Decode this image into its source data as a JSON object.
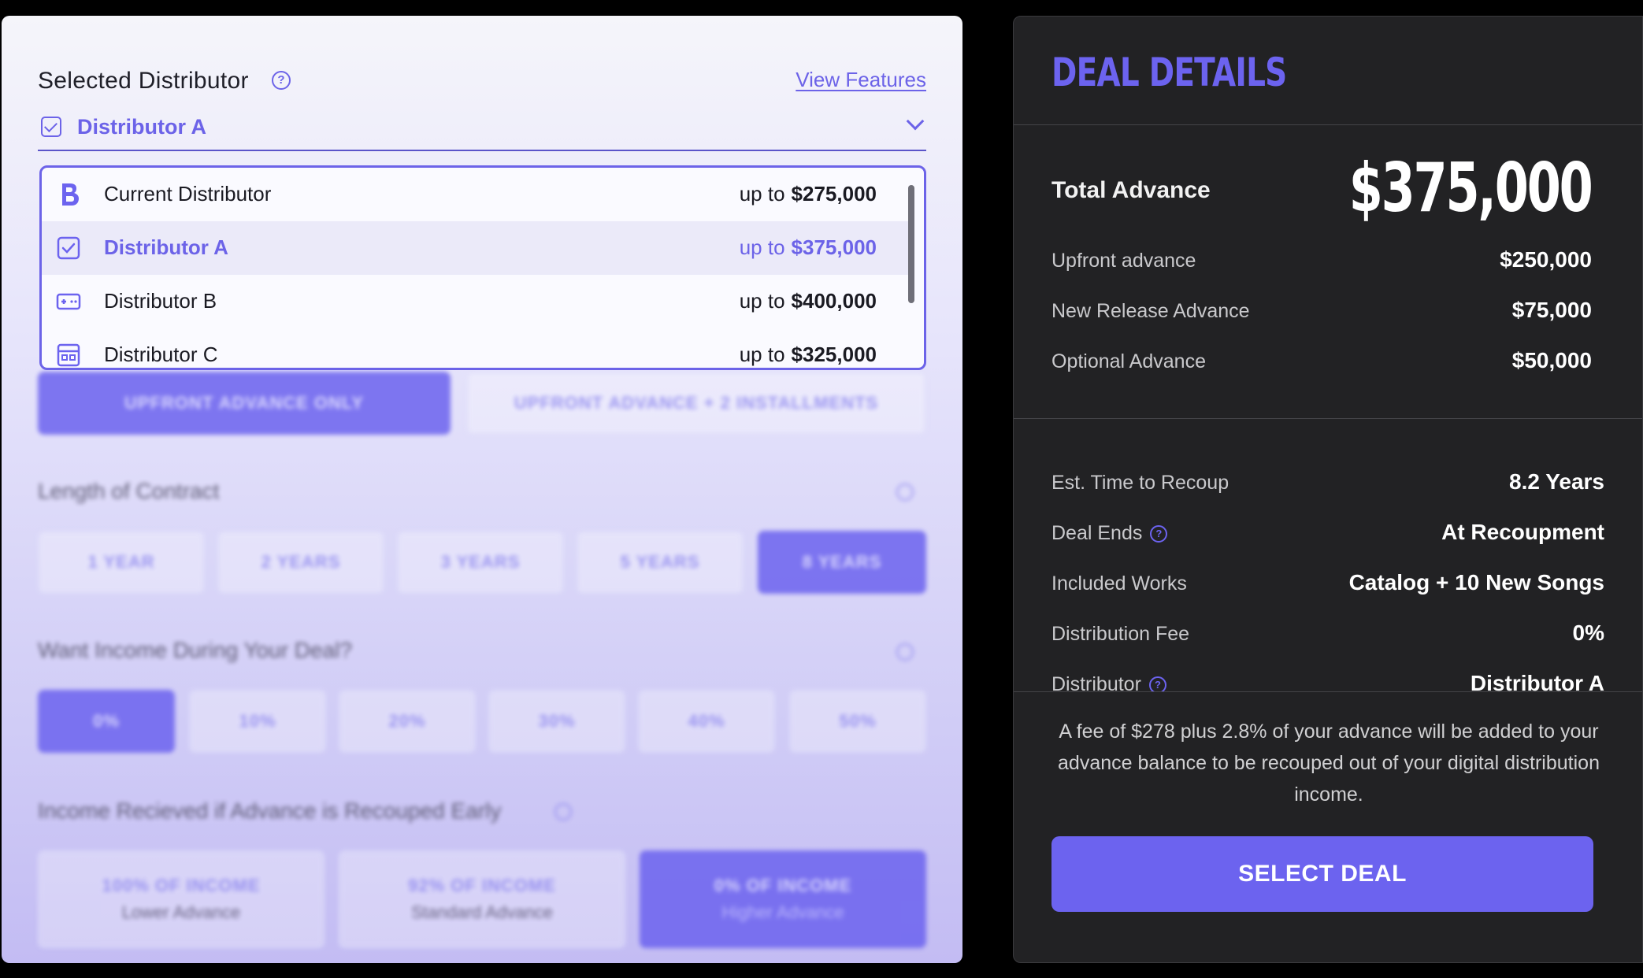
{
  "selector": {
    "title": "Selected Distributor",
    "view_features": "View Features",
    "current": "Distributor A"
  },
  "dropdown": {
    "items": [
      {
        "name": "Current Distributor",
        "prefix": "up to",
        "amount": "$275,000",
        "icon": "brand-b-icon"
      },
      {
        "name": "Distributor A",
        "prefix": "up to",
        "amount": "$375,000",
        "icon": "check-icon",
        "selected": true
      },
      {
        "name": "Distributor B",
        "prefix": "up to",
        "amount": "$400,000",
        "icon": "distributor-b-icon"
      },
      {
        "name": "Distributor C",
        "prefix": "up to",
        "amount": "$325,000",
        "icon": "distributor-c-icon"
      }
    ]
  },
  "blurred": {
    "advance_options": [
      "UPFRONT ADVANCE ONLY",
      "UPFRONT ADVANCE + 2 INSTALLMENTS"
    ],
    "length_title": "Length of Contract",
    "lengths": [
      "1 YEAR",
      "2 YEARS",
      "3 YEARS",
      "5 YEARS",
      "8 YEARS"
    ],
    "income_title": "Want Income During Your Deal?",
    "income_options": [
      "0%",
      "10%",
      "20%",
      "30%",
      "40%",
      "50%"
    ],
    "early_title": "Income Recieved if Advance is Recouped Early",
    "early_options": [
      {
        "label": "100% OF INCOME",
        "sub": "Lower Advance"
      },
      {
        "label": "92% OF INCOME",
        "sub": "Standard Advance"
      },
      {
        "label": "0% OF INCOME",
        "sub": "Higher Advance"
      }
    ]
  },
  "deal": {
    "title": "DEAL DETAILS",
    "total_label": "Total Advance",
    "total_value": "$375,000",
    "breakdown": [
      {
        "label": "Upfront advance",
        "value": "$250,000"
      },
      {
        "label": "New Release Advance",
        "value": "$75,000"
      },
      {
        "label": "Optional Advance",
        "value": "$50,000"
      }
    ],
    "details": [
      {
        "label": "Est. Time to Recoup",
        "value": "8.2 Years"
      },
      {
        "label": "Deal Ends",
        "value": "At Recoupment"
      },
      {
        "label": "Included Works",
        "value": "Catalog + 10 New Songs"
      },
      {
        "label": "Distribution Fee",
        "value": "0%"
      },
      {
        "label": "Distributor",
        "value": "Distributor A"
      }
    ],
    "fee_note": "A fee of $278 plus 2.8% of your advance will be added to your advance balance to be recouped out of your digital distribution income.",
    "select_button": "SELECT DEAL"
  },
  "colors": {
    "accent": "#6c63ef",
    "dark_panel": "#222224"
  }
}
